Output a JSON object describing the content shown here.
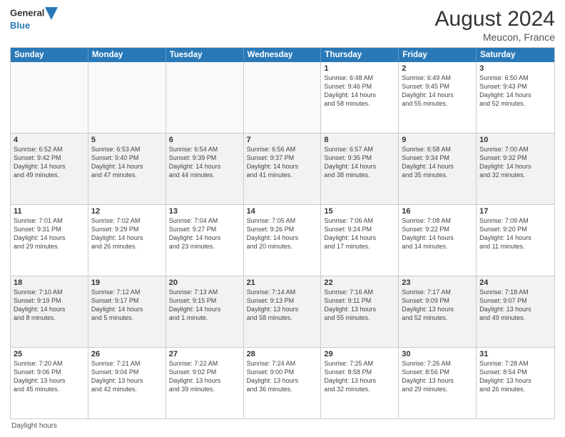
{
  "header": {
    "logo_line1": "General",
    "logo_line2": "Blue",
    "month_year": "August 2024",
    "location": "Meucon, France"
  },
  "days_of_week": [
    "Sunday",
    "Monday",
    "Tuesday",
    "Wednesday",
    "Thursday",
    "Friday",
    "Saturday"
  ],
  "weeks": [
    [
      {
        "day": "",
        "info": "",
        "empty": true
      },
      {
        "day": "",
        "info": "",
        "empty": true
      },
      {
        "day": "",
        "info": "",
        "empty": true
      },
      {
        "day": "",
        "info": "",
        "empty": true
      },
      {
        "day": "1",
        "info": "Sunrise: 6:48 AM\nSunset: 9:46 PM\nDaylight: 14 hours\nand 58 minutes.",
        "empty": false
      },
      {
        "day": "2",
        "info": "Sunrise: 6:49 AM\nSunset: 9:45 PM\nDaylight: 14 hours\nand 55 minutes.",
        "empty": false
      },
      {
        "day": "3",
        "info": "Sunrise: 6:50 AM\nSunset: 9:43 PM\nDaylight: 14 hours\nand 52 minutes.",
        "empty": false
      }
    ],
    [
      {
        "day": "4",
        "info": "Sunrise: 6:52 AM\nSunset: 9:42 PM\nDaylight: 14 hours\nand 49 minutes.",
        "empty": false
      },
      {
        "day": "5",
        "info": "Sunrise: 6:53 AM\nSunset: 9:40 PM\nDaylight: 14 hours\nand 47 minutes.",
        "empty": false
      },
      {
        "day": "6",
        "info": "Sunrise: 6:54 AM\nSunset: 9:39 PM\nDaylight: 14 hours\nand 44 minutes.",
        "empty": false
      },
      {
        "day": "7",
        "info": "Sunrise: 6:56 AM\nSunset: 9:37 PM\nDaylight: 14 hours\nand 41 minutes.",
        "empty": false
      },
      {
        "day": "8",
        "info": "Sunrise: 6:57 AM\nSunset: 9:35 PM\nDaylight: 14 hours\nand 38 minutes.",
        "empty": false
      },
      {
        "day": "9",
        "info": "Sunrise: 6:58 AM\nSunset: 9:34 PM\nDaylight: 14 hours\nand 35 minutes.",
        "empty": false
      },
      {
        "day": "10",
        "info": "Sunrise: 7:00 AM\nSunset: 9:32 PM\nDaylight: 14 hours\nand 32 minutes.",
        "empty": false
      }
    ],
    [
      {
        "day": "11",
        "info": "Sunrise: 7:01 AM\nSunset: 9:31 PM\nDaylight: 14 hours\nand 29 minutes.",
        "empty": false
      },
      {
        "day": "12",
        "info": "Sunrise: 7:02 AM\nSunset: 9:29 PM\nDaylight: 14 hours\nand 26 minutes.",
        "empty": false
      },
      {
        "day": "13",
        "info": "Sunrise: 7:04 AM\nSunset: 9:27 PM\nDaylight: 14 hours\nand 23 minutes.",
        "empty": false
      },
      {
        "day": "14",
        "info": "Sunrise: 7:05 AM\nSunset: 9:26 PM\nDaylight: 14 hours\nand 20 minutes.",
        "empty": false
      },
      {
        "day": "15",
        "info": "Sunrise: 7:06 AM\nSunset: 9:24 PM\nDaylight: 14 hours\nand 17 minutes.",
        "empty": false
      },
      {
        "day": "16",
        "info": "Sunrise: 7:08 AM\nSunset: 9:22 PM\nDaylight: 14 hours\nand 14 minutes.",
        "empty": false
      },
      {
        "day": "17",
        "info": "Sunrise: 7:09 AM\nSunset: 9:20 PM\nDaylight: 14 hours\nand 11 minutes.",
        "empty": false
      }
    ],
    [
      {
        "day": "18",
        "info": "Sunrise: 7:10 AM\nSunset: 9:19 PM\nDaylight: 14 hours\nand 8 minutes.",
        "empty": false
      },
      {
        "day": "19",
        "info": "Sunrise: 7:12 AM\nSunset: 9:17 PM\nDaylight: 14 hours\nand 5 minutes.",
        "empty": false
      },
      {
        "day": "20",
        "info": "Sunrise: 7:13 AM\nSunset: 9:15 PM\nDaylight: 14 hours\nand 1 minute.",
        "empty": false
      },
      {
        "day": "21",
        "info": "Sunrise: 7:14 AM\nSunset: 9:13 PM\nDaylight: 13 hours\nand 58 minutes.",
        "empty": false
      },
      {
        "day": "22",
        "info": "Sunrise: 7:16 AM\nSunset: 9:11 PM\nDaylight: 13 hours\nand 55 minutes.",
        "empty": false
      },
      {
        "day": "23",
        "info": "Sunrise: 7:17 AM\nSunset: 9:09 PM\nDaylight: 13 hours\nand 52 minutes.",
        "empty": false
      },
      {
        "day": "24",
        "info": "Sunrise: 7:18 AM\nSunset: 9:07 PM\nDaylight: 13 hours\nand 49 minutes.",
        "empty": false
      }
    ],
    [
      {
        "day": "25",
        "info": "Sunrise: 7:20 AM\nSunset: 9:06 PM\nDaylight: 13 hours\nand 45 minutes.",
        "empty": false
      },
      {
        "day": "26",
        "info": "Sunrise: 7:21 AM\nSunset: 9:04 PM\nDaylight: 13 hours\nand 42 minutes.",
        "empty": false
      },
      {
        "day": "27",
        "info": "Sunrise: 7:22 AM\nSunset: 9:02 PM\nDaylight: 13 hours\nand 39 minutes.",
        "empty": false
      },
      {
        "day": "28",
        "info": "Sunrise: 7:24 AM\nSunset: 9:00 PM\nDaylight: 13 hours\nand 36 minutes.",
        "empty": false
      },
      {
        "day": "29",
        "info": "Sunrise: 7:25 AM\nSunset: 8:58 PM\nDaylight: 13 hours\nand 32 minutes.",
        "empty": false
      },
      {
        "day": "30",
        "info": "Sunrise: 7:26 AM\nSunset: 8:56 PM\nDaylight: 13 hours\nand 29 minutes.",
        "empty": false
      },
      {
        "day": "31",
        "info": "Sunrise: 7:28 AM\nSunset: 8:54 PM\nDaylight: 13 hours\nand 26 minutes.",
        "empty": false
      }
    ]
  ],
  "footer": {
    "daylight_label": "Daylight hours"
  }
}
